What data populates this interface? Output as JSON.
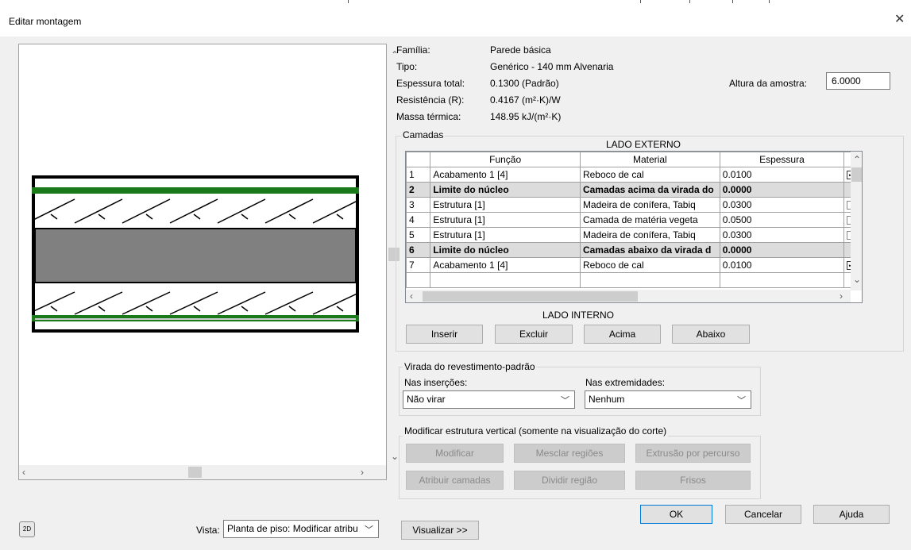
{
  "window": {
    "title": "Editar montagem",
    "close_glyph": "✕"
  },
  "props": {
    "familia_label": "Família:",
    "familia_value": "Parede básica",
    "tipo_label": "Tipo:",
    "tipo_value": "Genérico - 140 mm Alvenaria",
    "espessura_label": "Espessura total:",
    "espessura_value": "0.1300 (Padrão)",
    "resistencia_label": "Resistência (R):",
    "resistencia_value": "0.4167 (m²·K)/W",
    "massa_label": "Massa térmica:",
    "massa_value": "148.95 kJ/(m²·K)",
    "altura_label": "Altura da amostra:",
    "altura_value": "6.0000"
  },
  "camadas": {
    "group_label": "Camadas",
    "lado_externo": "LADO EXTERNO",
    "lado_interno": "LADO INTERNO",
    "headers": {
      "num": "",
      "funcao": "Função",
      "material": "Material",
      "espessura": "Espessura"
    },
    "rows": [
      {
        "num": "1",
        "funcao": "Acabamento 1 [4]",
        "material": "Reboco de cal",
        "espessura": "0.0100",
        "check": "on",
        "core": false
      },
      {
        "num": "2",
        "funcao": "Limite do núcleo",
        "material": "Camadas acima da virada do",
        "espessura": "0.0000",
        "check": "none",
        "core": true
      },
      {
        "num": "3",
        "funcao": "Estrutura [1]",
        "material": "Madeira de conífera, Tabiq",
        "espessura": "0.0300",
        "check": "off",
        "core": false
      },
      {
        "num": "4",
        "funcao": "Estrutura [1]",
        "material": "Camada de matéria vegeta",
        "espessura": "0.0500",
        "check": "off",
        "core": false
      },
      {
        "num": "5",
        "funcao": "Estrutura [1]",
        "material": "Madeira de conífera, Tabiq",
        "espessura": "0.0300",
        "check": "off",
        "core": false
      },
      {
        "num": "6",
        "funcao": "Limite do núcleo",
        "material": "Camadas abaixo da virada d",
        "espessura": "0.0000",
        "check": "none",
        "core": true
      },
      {
        "num": "7",
        "funcao": "Acabamento 1 [4]",
        "material": "Reboco de cal",
        "espessura": "0.0100",
        "check": "on",
        "core": false
      }
    ],
    "buttons": {
      "inserir": "Inserir",
      "excluir": "Excluir",
      "acima": "Acima",
      "abaixo": "Abaixo"
    }
  },
  "virada": {
    "group_label": "Virada do revestimento-padrão",
    "insercoes_label": "Nas inserções:",
    "insercoes_value": "Não virar",
    "extremidades_label": "Nas extremidades:",
    "extremidades_value": "Nenhum"
  },
  "vertical": {
    "group_label": "Modificar estrutura vertical (somente na visualização do corte)",
    "buttons": {
      "modificar": "Modificar",
      "mesclar": "Mesclar regiões",
      "extrusao": "Extrusão por percurso",
      "atribuir": "Atribuir camadas",
      "dividir": "Dividir região",
      "frisos": "Frisos"
    }
  },
  "footer": {
    "ok": "OK",
    "cancelar": "Cancelar",
    "ajuda": "Ajuda",
    "vista_label": "Vista:",
    "vista_value": "Planta de piso: Modificar atribu",
    "visualizar": "Visualizar >>"
  },
  "icons": {
    "view2d": "2D"
  }
}
